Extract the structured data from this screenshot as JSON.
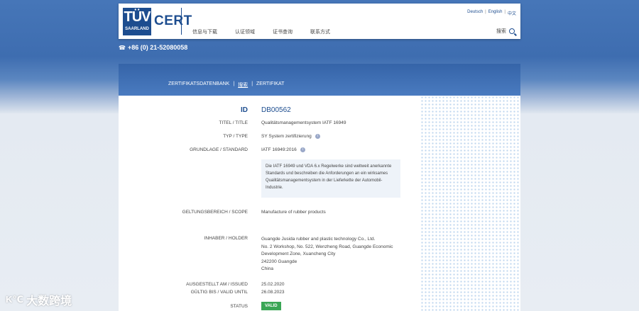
{
  "header": {
    "logo_top": "TÜV",
    "logo_bottom": "SAARLAND",
    "brand": "CERT",
    "nav": [
      "信息与下载",
      "认证领域",
      "证书查询",
      "联系方式"
    ],
    "languages": [
      "Deutsch",
      "English",
      "中文"
    ],
    "search_label": "搜索"
  },
  "contact": {
    "phone": "+86 (0) 21-52080058"
  },
  "breadcrumb": [
    "ZERTIFIKATSDATENBANK",
    "搜索",
    "ZERTIFIKAT"
  ],
  "certificate": {
    "id_label": "ID",
    "id_value": "DB00562",
    "title_label": "TITEL / TITLE",
    "title_value": "Qualitätsmanagementsystem IATF 16949",
    "type_label": "TYP / TYPE",
    "type_value": "SY System zertifizierung",
    "standard_label": "GRUNDLAGE / STANDARD",
    "standard_value": "IATF 16949:2016",
    "standard_info": "Die IATF 16949 und VDA 6.x Regelwerke sind weltweit anerkannte Standards und beschreiben die Anforderungen an ein wirksames Qualitätsmanagementsystem in der Lieferkette der Automobil-Industrie.",
    "scope_label": "GELTUNGSBEREICH / SCOPE",
    "scope_value": "Manufacture of rubber products",
    "holder_label": "INHABER / HOLDER",
    "holder_lines": [
      "Guangde Jusida rubber and plastic technology Co., Ltd.",
      "No. 2 Workshop, No. 522, Wenzheng Road, Guangde Economic",
      "Development Zone, Xuancheng City",
      "242200 Guangde",
      "China"
    ],
    "issued_label": "AUSGESTELLT AM / ISSUED",
    "issued_value": "25.02.2020",
    "valid_label": "GÜLTIG BIS / VALID UNTIL",
    "valid_value": "26.08.2023",
    "status_label": "STATUS",
    "status_value": "VALID"
  },
  "watermark": {
    "text": "大数跨境",
    "mark": "K℃"
  },
  "colors": {
    "brand_blue": "#1d4d8f",
    "status_green": "#3aa655"
  }
}
